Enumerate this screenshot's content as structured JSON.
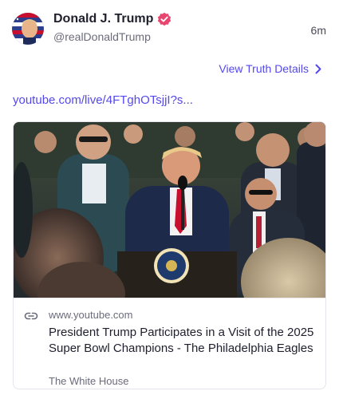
{
  "post": {
    "author": {
      "display_name": "Donald J. Trump",
      "handle": "@realDonaldTrump",
      "verified": true,
      "avatar_icon": "profile-avatar"
    },
    "timestamp": "6m",
    "details_link": {
      "label": "View Truth Details",
      "icon": "chevron-right-icon"
    },
    "url_text": "youtube.com/live/4FTghOTsjjI?s...",
    "link_card": {
      "domain": "www.youtube.com",
      "title": "President Trump Participates in a Visit of the 2025 Super Bowl Champions - The Philadelphia Eagles",
      "source": "The White House",
      "icon": "link-icon"
    }
  },
  "colors": {
    "accent": "#5448ee",
    "verified_badge": "#e8466f",
    "text_primary": "#1f1f2e",
    "text_secondary": "#6b6b7b",
    "card_border": "#e4e4ea"
  }
}
